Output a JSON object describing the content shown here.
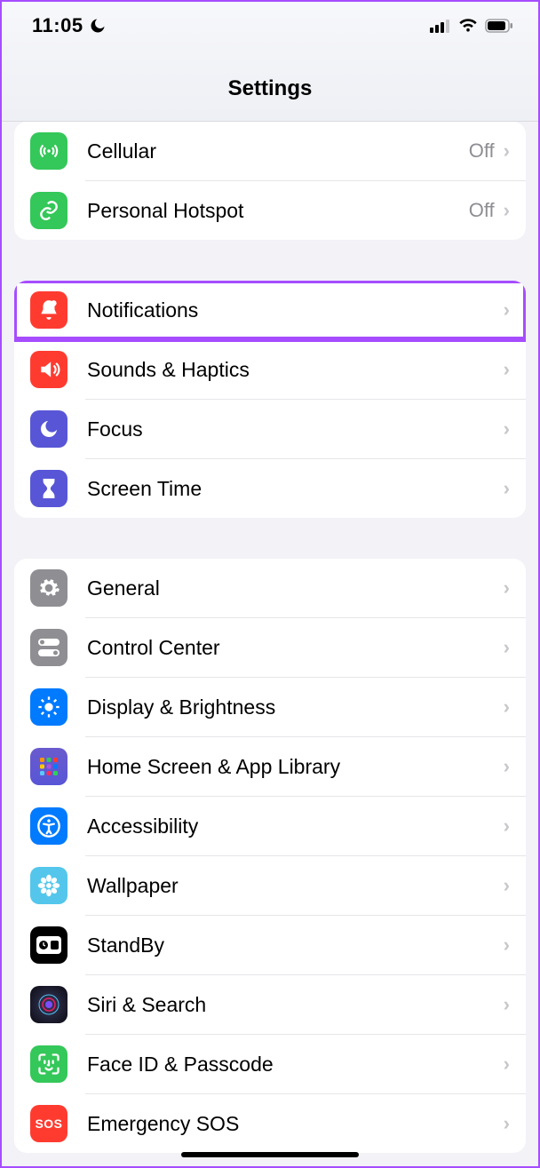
{
  "status": {
    "time": "11:05"
  },
  "header": {
    "title": "Settings"
  },
  "sections": [
    {
      "rows": [
        {
          "icon": "antenna-icon",
          "label": "Cellular",
          "value": "Off",
          "bg": "bg-green"
        },
        {
          "icon": "link-icon",
          "label": "Personal Hotspot",
          "value": "Off",
          "bg": "bg-green"
        }
      ]
    },
    {
      "rows": [
        {
          "icon": "bell-icon",
          "label": "Notifications",
          "bg": "bg-red",
          "highlight": true
        },
        {
          "icon": "speaker-icon",
          "label": "Sounds & Haptics",
          "bg": "bg-red"
        },
        {
          "icon": "moon-icon",
          "label": "Focus",
          "bg": "bg-purple"
        },
        {
          "icon": "hourglass-icon",
          "label": "Screen Time",
          "bg": "bg-purple"
        }
      ]
    },
    {
      "rows": [
        {
          "icon": "gear-icon",
          "label": "General",
          "bg": "bg-gray"
        },
        {
          "icon": "toggles-icon",
          "label": "Control Center",
          "bg": "bg-gray"
        },
        {
          "icon": "sun-icon",
          "label": "Display & Brightness",
          "bg": "bg-blue"
        },
        {
          "icon": "grid-icon",
          "label": "Home Screen & App Library",
          "bg": "bg-apps"
        },
        {
          "icon": "access-icon",
          "label": "Accessibility",
          "bg": "bg-blue"
        },
        {
          "icon": "flower-icon",
          "label": "Wallpaper",
          "bg": "bg-teal"
        },
        {
          "icon": "standby-icon",
          "label": "StandBy",
          "bg": "bg-black"
        },
        {
          "icon": "siri-icon",
          "label": "Siri & Search",
          "bg": "bg-siri"
        },
        {
          "icon": "faceid-icon",
          "label": "Face ID & Passcode",
          "bg": "bg-lgreen"
        },
        {
          "icon": "sos-icon",
          "label": "Emergency SOS",
          "bg": "bg-sos"
        }
      ]
    }
  ]
}
